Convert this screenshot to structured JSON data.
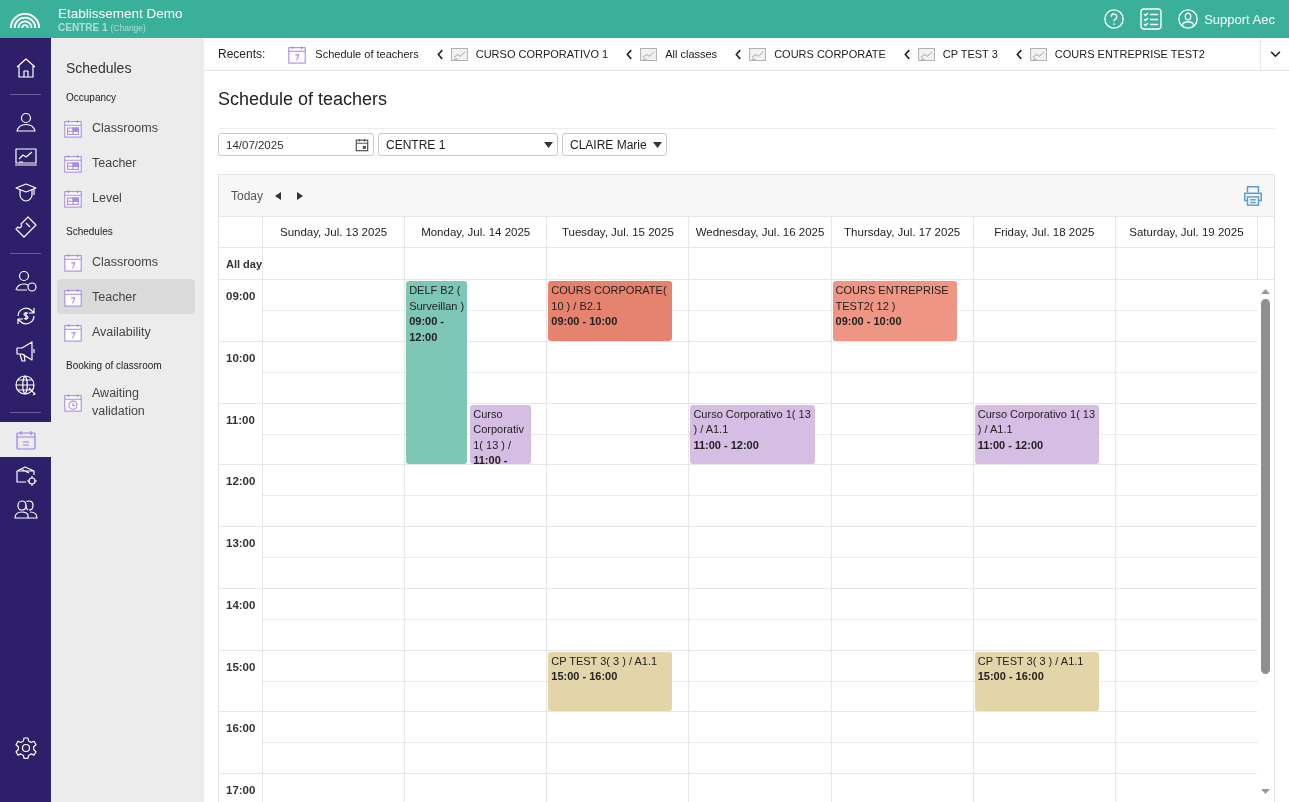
{
  "header": {
    "title": "Etablissement Demo",
    "centre": "CENTRE 1",
    "change": "(Change)",
    "user": "Support Aec"
  },
  "rail": {
    "groups": [
      [
        {
          "kind": "home",
          "selected": false
        }
      ],
      [
        {
          "kind": "user",
          "selected": false
        },
        {
          "kind": "board",
          "selected": false
        },
        {
          "kind": "graduate",
          "selected": false
        },
        {
          "kind": "ticket",
          "selected": false
        }
      ],
      [
        {
          "kind": "payer",
          "selected": false
        },
        {
          "kind": "refund",
          "selected": false
        },
        {
          "kind": "megaphone",
          "selected": false
        },
        {
          "kind": "globe",
          "selected": false
        }
      ],
      [
        {
          "kind": "calendar",
          "selected": true
        },
        {
          "kind": "box",
          "selected": false
        },
        {
          "kind": "users",
          "selected": false
        }
      ]
    ],
    "bottom": [
      {
        "kind": "settings",
        "selected": false
      }
    ]
  },
  "submenu": {
    "title": "Schedules",
    "sections": [
      {
        "heading": "Occupancy",
        "items": [
          {
            "label": "Classrooms",
            "kind": "grid",
            "selected": false
          },
          {
            "label": "Teacher",
            "kind": "grid",
            "selected": false
          },
          {
            "label": "Level",
            "kind": "grid",
            "selected": false
          }
        ]
      },
      {
        "heading": "Schedules",
        "items": [
          {
            "label": "Classrooms",
            "kind": "day",
            "selected": false
          },
          {
            "label": "Teacher",
            "kind": "day",
            "selected": true
          },
          {
            "label": "Availability",
            "kind": "day",
            "selected": false
          }
        ]
      },
      {
        "heading": "Booking of classroom",
        "items": [
          {
            "label": "Awaiting validation",
            "kind": "clock",
            "selected": false
          }
        ]
      }
    ]
  },
  "recents": {
    "label": "Recents:",
    "items": [
      {
        "label": "Schedule of teachers",
        "kind": "calendar"
      },
      {
        "label": "CURSO CORPORATIVO 1",
        "kind": "chart"
      },
      {
        "label": "All classes",
        "kind": "chart"
      },
      {
        "label": "COURS CORPORATE",
        "kind": "chart"
      },
      {
        "label": "CP TEST 3",
        "kind": "chart"
      },
      {
        "label": "COURS ENTREPRISE TEST2",
        "kind": "chart"
      }
    ]
  },
  "page_title": "Schedule of teachers",
  "filters": {
    "date": "14/07/2025",
    "centre": "CENTRE 1",
    "teacher": "CLAIRE Marie"
  },
  "calendar": {
    "today": "Today",
    "all_day": "All day",
    "hours": [
      "09:00",
      "10:00",
      "11:00",
      "12:00",
      "13:00",
      "14:00",
      "15:00",
      "16:00",
      "17:00"
    ],
    "days": [
      {
        "label": "Sunday, Jul. 13 2025"
      },
      {
        "label": "Monday, Jul. 14 2025",
        "events": [
          {
            "title": "DELF B2 ( Surveillan )",
            "time": "09:00 - 12:00",
            "color": "#7ec6b6"
          },
          {
            "title": "Curso Corporativ 1( 13 ) /",
            "time": "11:00 -",
            "color": "#d5bde3"
          }
        ]
      },
      {
        "label": "Tuesday, Jul. 15 2025",
        "events": [
          {
            "title": "COURS CORPORATE( 10 ) / B2.1",
            "time": "09:00 - 10:00",
            "color": "#e6836f"
          },
          {
            "title": "CP TEST 3( 3 ) / A1.1",
            "time": "15:00 - 16:00",
            "color": "#e3d5a8"
          }
        ]
      },
      {
        "label": "Wednesday, Jul. 16 2025",
        "events": [
          {
            "title": "Curso Corporativo 1( 13 ) / A1.1",
            "time": "11:00 - 12:00",
            "color": "#d5bde3"
          }
        ]
      },
      {
        "label": "Thursday, Jul. 17 2025",
        "events": [
          {
            "title": "COURS ENTREPRISE TEST2( 12 )",
            "time": "09:00 - 10:00",
            "color": "#ef9584"
          }
        ]
      },
      {
        "label": "Friday, Jul. 18 2025",
        "events": [
          {
            "title": "Curso Corporativo 1( 13 ) / A1.1",
            "time": "11:00 - 12:00",
            "color": "#d5bde3"
          },
          {
            "title": "CP TEST 3( 3 ) / A1.1",
            "time": "15:00 - 16:00",
            "color": "#e3d5a8"
          }
        ]
      },
      {
        "label": "Saturday, Jul. 19 2025"
      }
    ]
  }
}
